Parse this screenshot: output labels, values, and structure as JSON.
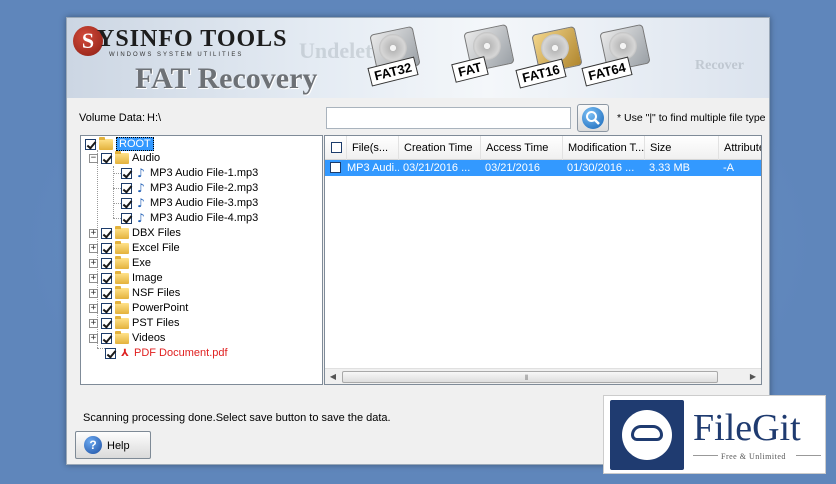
{
  "banner": {
    "brand": "YSINFO TOOLS",
    "brand_initial": "S",
    "tagline": "WINDOWS SYSTEM UTILITIES",
    "app_title": "FAT Recovery",
    "watermark_left": "Undelete",
    "watermark_right": "Recover",
    "drive_tags": [
      "FAT32",
      "FAT",
      "FAT16",
      "FAT64"
    ]
  },
  "search": {
    "volume_label": "Volume Data:",
    "volume_value": "H:\\",
    "input_value": "",
    "hint": "* Use \"|\" to find multiple file type"
  },
  "tree": {
    "root": "ROOT",
    "audio_folder": "Audio",
    "audio_files": [
      "MP3 Audio File-1.mp3",
      "MP3 Audio File-2.mp3",
      "MP3 Audio File-3.mp3",
      "MP3 Audio File-4.mp3"
    ],
    "folders": [
      "DBX Files",
      "Excel File",
      "Exe",
      "Image",
      "NSF Files",
      "PowerPoint",
      "PST Files",
      "Videos"
    ],
    "pdf_file": "PDF Document.pdf"
  },
  "grid": {
    "columns": [
      "File(s...",
      "Creation Time",
      "Access Time",
      "Modification T...",
      "Size",
      "Attribute"
    ],
    "rows": [
      {
        "name": "MP3 Audi...",
        "created": "03/21/2016  ...",
        "accessed": "03/21/2016",
        "modified": "01/30/2016  ...",
        "size": "3.33 MB",
        "attr": "-A"
      }
    ]
  },
  "status": {
    "message": "Scanning processing done.Select save button to save the data."
  },
  "help": {
    "label": "Help",
    "icon": "?"
  },
  "filegit": {
    "name": "FileGit",
    "subtitle": "Free & Unlimited"
  },
  "colors": {
    "desktop": "#5f86bb",
    "selection": "#3399ff",
    "red_file": "#e02020",
    "filegit_navy": "#1f3b70"
  }
}
